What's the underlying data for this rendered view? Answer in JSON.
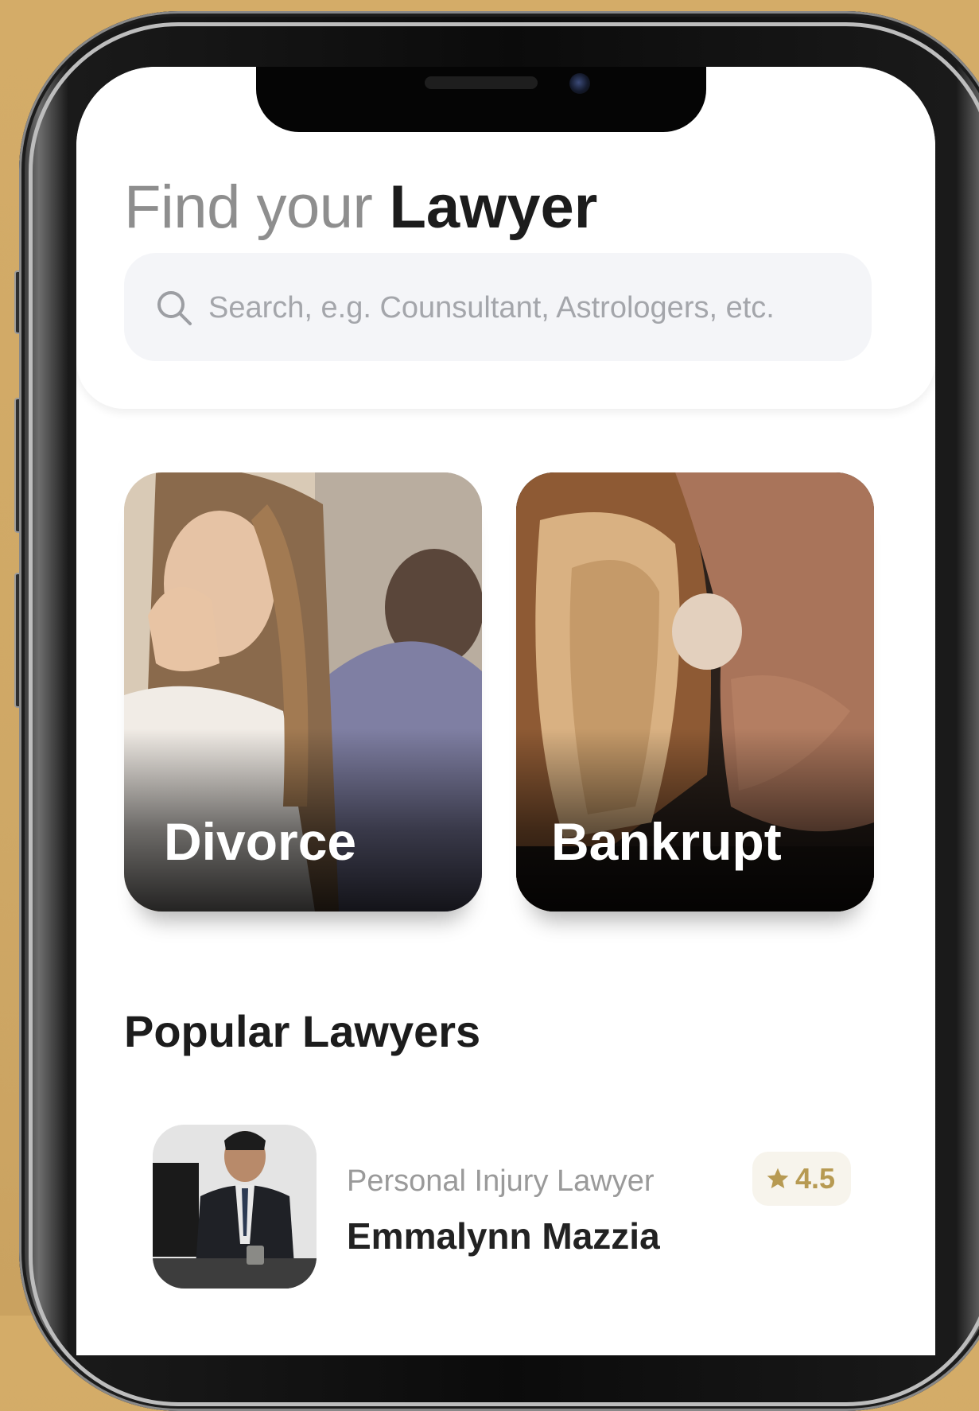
{
  "header": {
    "title_light": "Find your",
    "title_bold": "Lawyer"
  },
  "search": {
    "placeholder": "Search, e.g. Counsultant, Astrologers, etc.",
    "icon": "search-icon"
  },
  "categories": [
    {
      "label": "Divorce"
    },
    {
      "label": "Bankrupt"
    }
  ],
  "popular": {
    "section_title": "Popular Lawyers",
    "lawyers": [
      {
        "role": "Personal Injury Lawyer",
        "name": "Emmalynn Mazzia",
        "rating": "4.5"
      }
    ]
  },
  "colors": {
    "background": "#d4ac68",
    "accent": "#b79a52",
    "title_bold": "#1c1c1c",
    "muted_text": "#9a9a9a",
    "search_bg": "#f4f5f8"
  }
}
